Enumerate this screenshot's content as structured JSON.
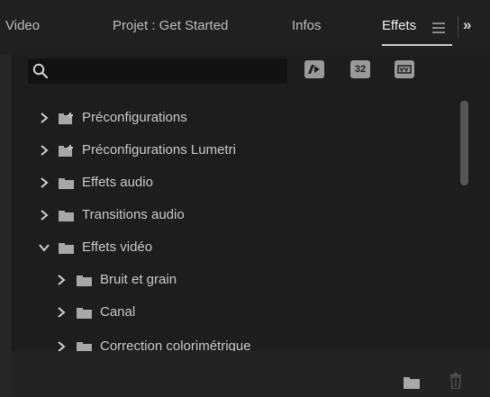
{
  "tabs": {
    "video": "Video",
    "project": "Projet : Get Started",
    "infos": "Infos",
    "effects": "Effets",
    "overflow": "»"
  },
  "search": {
    "value": "",
    "placeholder": ""
  },
  "filters": {
    "yuv_label": "32"
  },
  "tree": [
    {
      "label": "Préconfigurations",
      "expanded": false,
      "folder_type": "preset",
      "level": 0
    },
    {
      "label": "Préconfigurations Lumetri",
      "expanded": false,
      "folder_type": "preset",
      "level": 0
    },
    {
      "label": "Effets audio",
      "expanded": false,
      "folder_type": "folder",
      "level": 0
    },
    {
      "label": "Transitions audio",
      "expanded": false,
      "folder_type": "folder",
      "level": 0
    },
    {
      "label": "Effets vidéo",
      "expanded": true,
      "folder_type": "folder",
      "level": 0
    },
    {
      "label": "Bruit et grain",
      "expanded": false,
      "folder_type": "folder",
      "level": 1
    },
    {
      "label": "Canal",
      "expanded": false,
      "folder_type": "folder",
      "level": 1
    },
    {
      "label": "Correction colorimétrique",
      "expanded": false,
      "folder_type": "folder",
      "level": 1
    }
  ],
  "colors": {
    "background": "#1d1d1d",
    "text": "#c9c9c9",
    "active_tab": "#f0f0f0",
    "icon": "#a8a8a8"
  }
}
